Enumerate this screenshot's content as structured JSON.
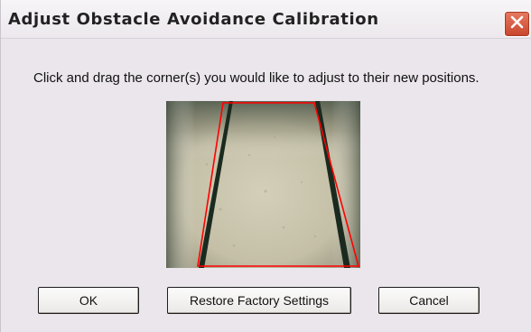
{
  "window": {
    "title": "Adjust Obstacle Avoidance Calibration",
    "close_icon": "close-icon"
  },
  "main": {
    "instructions": "Click and drag the corner(s) you would like to adjust to their new positions."
  },
  "preview": {
    "overlay_color": "#ff0000",
    "content": "camera view of floor with two dark stripes"
  },
  "buttons": {
    "ok_label": "OK",
    "restore_label": "Restore Factory Settings",
    "cancel_label": "Cancel"
  }
}
